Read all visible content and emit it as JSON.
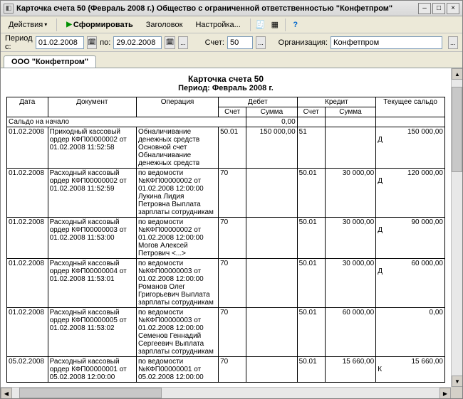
{
  "window": {
    "title": "Карточка счета 50 (Февраль 2008 г.) Общество с ограниченной ответственностью \"Конфетпром\""
  },
  "toolbar": {
    "actions_label": "Действия",
    "form_label": "Сформировать",
    "header_label": "Заголовок",
    "settings_label": "Настройка..."
  },
  "filter": {
    "period_label": "Период с:",
    "date_from": "01.02.2008",
    "to_label": "по:",
    "date_to": "29.02.2008",
    "ellipsis": "...",
    "account_label": "Счет:",
    "account": "50",
    "org_label": "Организация:",
    "org": "Конфетпром"
  },
  "tab": {
    "label": "ООО \"Конфетпром\""
  },
  "report": {
    "title": "Карточка счета 50",
    "period": "Период: Февраль 2008 г.",
    "headers": {
      "date": "Дата",
      "doc": "Документ",
      "op": "Операция",
      "debit": "Дебет",
      "credit": "Кредит",
      "balance": "Текущее сальдо",
      "account": "Счет",
      "sum": "Сумма"
    },
    "opening_label": "Сальдо на начало",
    "opening_value": "0,00",
    "rows": [
      {
        "date": "01.02.2008",
        "doc": "Приходный кассовый ордер КФП00000002 от 01.02.2008 11:52:58",
        "op": "Обналичивание денежных средств Основной счет Обналичивание денежных средств",
        "d_acct": "50.01",
        "d_sum": "150 000,00",
        "c_acct": "51",
        "c_sum": "",
        "bal_sign": "Д",
        "bal_val": "150 000,00"
      },
      {
        "date": "01.02.2008",
        "doc": "Расходный кассовый ордер КФП00000002 от 01.02.2008 11:52:59",
        "op": "  по ведомости №КФП00000002 от 01.02.2008 12:00:00 Лукина Лидия Петровна Выплата зарплаты сотрудникам",
        "d_acct": "70",
        "d_sum": "",
        "c_acct": "50.01",
        "c_sum": "30 000,00",
        "bal_sign": "Д",
        "bal_val": "120 000,00"
      },
      {
        "date": "01.02.2008",
        "doc": "Расходный кассовый ордер КФП00000003 от 01.02.2008 11:53:00",
        "op": "  по ведомости №КФП00000002 от 01.02.2008 12:00:00 Могов Алексей Петрович <...>",
        "d_acct": "70",
        "d_sum": "",
        "c_acct": "50.01",
        "c_sum": "30 000,00",
        "bal_sign": "Д",
        "bal_val": "90 000,00"
      },
      {
        "date": "01.02.2008",
        "doc": "Расходный кассовый ордер КФП00000004 от 01.02.2008 11:53:01",
        "op": "  по ведомости №КФП00000003 от 01.02.2008 12:00:00 Романов Олег Григорьевич Выплата зарплаты сотрудникам",
        "d_acct": "70",
        "d_sum": "",
        "c_acct": "50.01",
        "c_sum": "30 000,00",
        "bal_sign": "Д",
        "bal_val": "60 000,00"
      },
      {
        "date": "01.02.2008",
        "doc": "Расходный кассовый ордер КФП00000005 от 01.02.2008 11:53:02",
        "op": "  по ведомости №КФП00000003 от 01.02.2008 12:00:00 Семенов Геннадий Сергеевич Выплата зарплаты сотрудникам",
        "d_acct": "70",
        "d_sum": "",
        "c_acct": "50.01",
        "c_sum": "60 000,00",
        "bal_sign": "",
        "bal_val": "0,00"
      },
      {
        "date": "05.02.2008",
        "doc": "Расходный кассовый ордер КФП00000001 от 05.02.2008 12:00:00",
        "op": "  по ведомости №КФП00000001 от 05.02.2008 12:00:00",
        "d_acct": "70",
        "d_sum": "",
        "c_acct": "50.01",
        "c_sum": "15 660,00",
        "bal_sign": "К",
        "bal_val": "15 660,00"
      }
    ]
  }
}
